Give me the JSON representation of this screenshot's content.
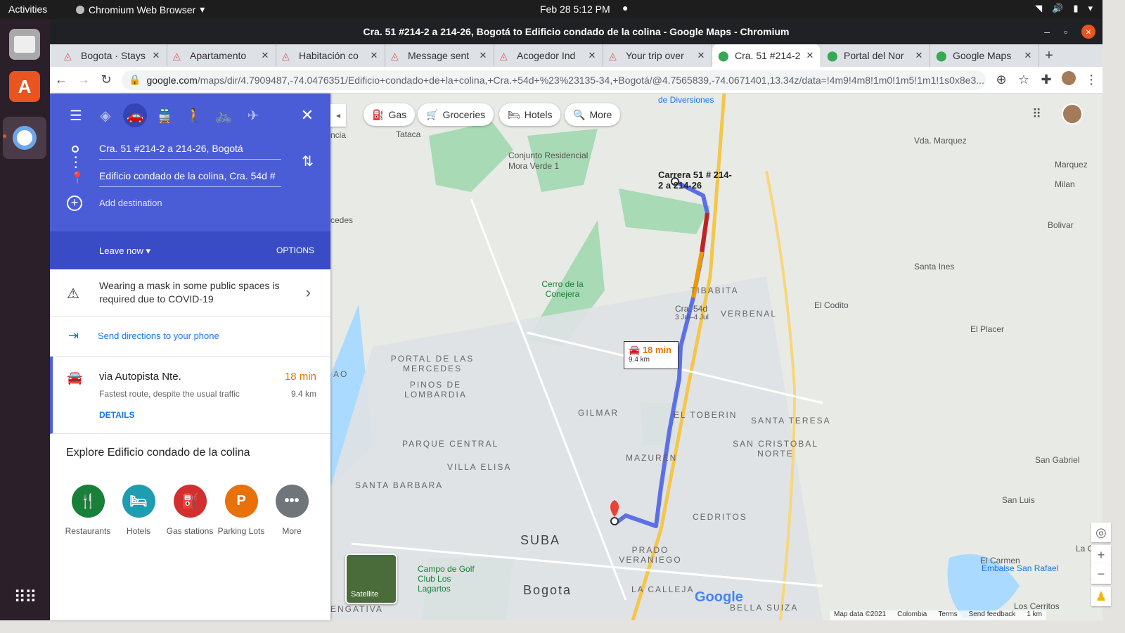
{
  "system": {
    "activities": "Activities",
    "app_name": "Chromium Web Browser",
    "clock": "Feb 28  5:12 PM"
  },
  "window": {
    "title": "Cra. 51 #214-2 a 214-26, Bogotá to Edificio condado de la colina - Google Maps - Chromium"
  },
  "tabs": [
    {
      "label": "Bogota · Stays",
      "icon": "airbnb-icon"
    },
    {
      "label": "Apartamento",
      "icon": "airbnb-icon"
    },
    {
      "label": "Habitación co",
      "icon": "airbnb-icon"
    },
    {
      "label": "Message sent",
      "icon": "airbnb-icon"
    },
    {
      "label": "Acogedor Ind",
      "icon": "airbnb-icon"
    },
    {
      "label": "Your trip over",
      "icon": "airbnb-icon"
    },
    {
      "label": "Cra. 51 #214-2",
      "icon": "maps-pin-icon",
      "active": true
    },
    {
      "label": "Portal del Nor",
      "icon": "maps-pin-icon"
    },
    {
      "label": "Google Maps",
      "icon": "maps-pin-icon"
    }
  ],
  "address_bar": {
    "domain": "google.com",
    "path": "/maps/dir/4.7909487,-74.0476351/Edificio+condado+de+la+colina,+Cra.+54d+%23%23135-34,+Bogotá/@4.7565839,-74.0671401,13.34z/data=!4m9!4m8!1m0!1m5!1m1!1s0x8e3..."
  },
  "directions": {
    "origin": "Cra. 51 #214-2 a 214-26, Bogotá",
    "destination": "Edificio condado de la colina, Cra. 54d #",
    "add_destination": "Add destination",
    "leave_now": "Leave now",
    "options": "OPTIONS",
    "covid_notice": "Wearing a mask in some public spaces is required due to COVID-19",
    "send_to_phone": "Send directions to your phone",
    "route": {
      "name": "via Autopista Nte.",
      "summary": "Fastest route, despite the usual traffic",
      "time": "18 min",
      "distance": "9.4 km",
      "details": "DETAILS"
    },
    "explore_title": "Explore Edificio condado de la colina",
    "categories": [
      {
        "label": "Restaurants",
        "color": "#188038",
        "glyph": "🍴"
      },
      {
        "label": "Hotels",
        "color": "#1e9db0",
        "glyph": "🛏"
      },
      {
        "label": "Gas stations",
        "color": "#d32f2f",
        "glyph": "⛽"
      },
      {
        "label": "Parking Lots",
        "color": "#e8710a",
        "glyph": "P"
      },
      {
        "label": "More",
        "color": "#70757a",
        "glyph": "•••"
      }
    ]
  },
  "map": {
    "chips": [
      "Gas",
      "Groceries",
      "Hotels",
      "More"
    ],
    "route_box": {
      "time": "18 min",
      "distance": "9.4 km"
    },
    "start_label": "Carrera 51 # 214-2 a 214-26",
    "labels": [
      "de Diversiones",
      "Tataca",
      "Conjunto Residencial Mora Verde 1",
      "Vda. Marquez",
      "Marquez",
      "Milan",
      "Bolivar",
      "Santa Ines",
      "El Codito",
      "El Placer",
      "Cerro de la Conejera",
      "Cra. 54d",
      "3 Jul–4 Jul",
      "TIBABITA",
      "VERBENAL",
      "PORTAL DE LAS MERCEDES",
      "PINOS DE LOMBARDIA",
      "GILMAR",
      "EL TOBERIN",
      "SANTA TERESA",
      "PARQUE CENTRAL",
      "SAN CRISTOBAL NORTE",
      "VILLA ELISA",
      "MAZUREN",
      "SANTA BARBARA",
      "CEDRITOS",
      "SUBA",
      "PRADO VERANIEGO",
      "Bogota",
      "LA CALLEJA",
      "BELLA SUIZA",
      "San Gabriel",
      "San Luis",
      "El Carmen",
      "Embalse San Rafael",
      "Los Cerritos",
      "Campo de Golf Club Los Lagartos",
      "ENGATIVA",
      "cedes",
      "ncia",
      "La Calera",
      "AO"
    ],
    "satellite": "Satellite",
    "footer": [
      "Map data ©2021",
      "Colombia",
      "Terms",
      "Send feedback",
      "1 km"
    ]
  }
}
